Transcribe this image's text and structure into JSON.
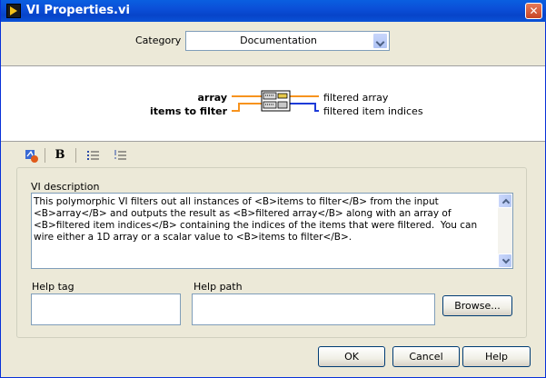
{
  "window": {
    "title": "VI Properties.vi",
    "close_glyph": "✕"
  },
  "category": {
    "label": "Category",
    "value": "Documentation"
  },
  "connector": {
    "inputs": [
      {
        "label": "array"
      },
      {
        "label": "items to filter"
      }
    ],
    "outputs": [
      {
        "label": "filtered array"
      },
      {
        "label": "filtered item indices"
      }
    ],
    "wire_colors": {
      "orange": "#f7931e",
      "blue": "#1d3bd8"
    }
  },
  "toolbar": {
    "icons": [
      "insert-style-icon",
      "bold-icon",
      "bullet-list-icon",
      "numbered-list-icon"
    ],
    "bold_glyph": "B"
  },
  "description": {
    "label": "VI description",
    "text": "This polymorphic VI filters out all instances of <B>items to filter</B> from the input <B>array</B> and outputs the result as <B>filtered array</B> along with an array of <B>filtered item indices</B> containing the indices of the items that were filtered.  You can wire either a 1D array or a scalar value to <B>items to filter</B>."
  },
  "help_tag": {
    "label": "Help tag",
    "value": ""
  },
  "help_path": {
    "label": "Help path",
    "value": ""
  },
  "buttons": {
    "browse": "Browse...",
    "ok": "OK",
    "cancel": "Cancel",
    "help": "Help"
  }
}
